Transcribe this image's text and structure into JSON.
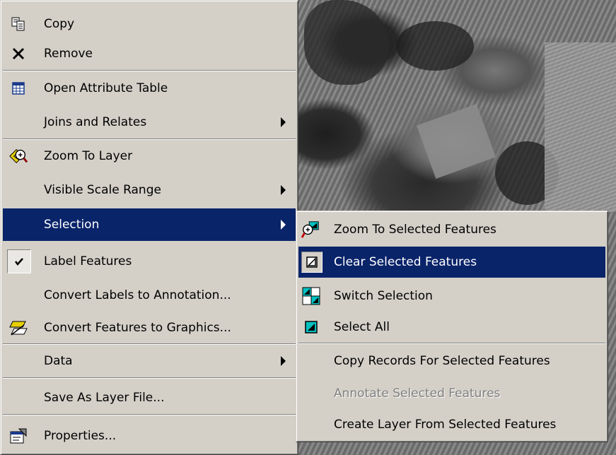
{
  "main_menu": {
    "items": [
      {
        "label": "Copy",
        "icon": "copy-icon"
      },
      {
        "label": "Remove",
        "icon": "remove-icon"
      },
      {
        "label": "Open Attribute Table",
        "icon": "table-icon"
      },
      {
        "label": "Joins and Relates"
      },
      {
        "label": "Zoom To Layer",
        "icon": "zoom-to-layer-icon"
      },
      {
        "label": "Visible Scale Range"
      },
      {
        "label": "Selection"
      },
      {
        "label": "Label Features",
        "checked": true
      },
      {
        "label": "Convert Labels to Annotation..."
      },
      {
        "label": "Convert Features to Graphics...",
        "icon": "convert-graphics-icon"
      },
      {
        "label": "Data"
      },
      {
        "label": "Save As Layer File..."
      },
      {
        "label": "Properties...",
        "icon": "properties-icon"
      }
    ]
  },
  "selection_submenu": {
    "items": [
      {
        "label": "Zoom To Selected Features",
        "icon": "zoom-selected-icon"
      },
      {
        "label": "Clear Selected Features",
        "icon": "clear-selection-icon"
      },
      {
        "label": "Switch Selection",
        "icon": "switch-selection-icon"
      },
      {
        "label": "Select All",
        "icon": "select-all-icon"
      },
      {
        "label": "Copy Records For Selected Features"
      },
      {
        "label": "Annotate Selected Features",
        "disabled": true
      },
      {
        "label": "Create Layer From Selected Features"
      }
    ]
  },
  "colors": {
    "menu_bg": "#d4d0c8",
    "highlight": "#0a246a",
    "highlight_text": "#ffffff",
    "disabled_text": "#808080"
  }
}
